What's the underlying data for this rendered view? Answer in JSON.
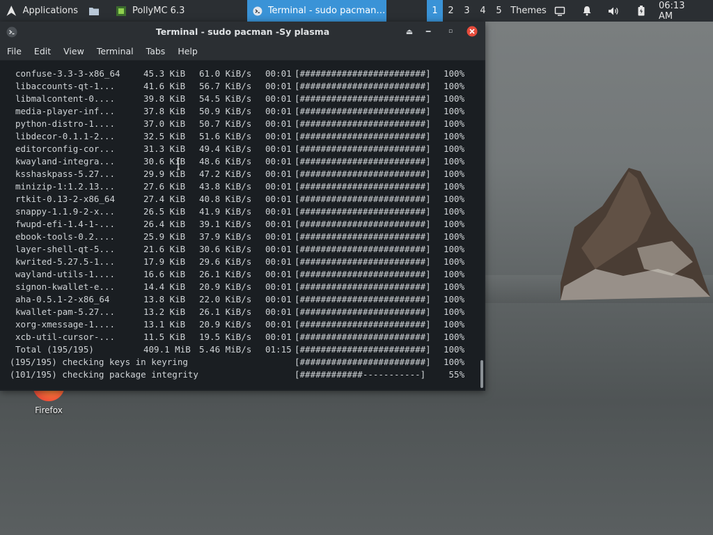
{
  "panel": {
    "applications_label": "Applications",
    "tasks": [
      {
        "label": "PollyMC 6.3"
      },
      {
        "label": "Terminal - sudo pacman -Sy ..."
      }
    ],
    "workspaces": [
      "1",
      "2",
      "3",
      "4",
      "5"
    ],
    "active_workspace": "1",
    "themes_label": "Themes",
    "clock": "06:13 AM"
  },
  "window": {
    "title": "Terminal - sudo pacman -Sy plasma",
    "menu": [
      "File",
      "Edit",
      "View",
      "Terminal",
      "Tabs",
      "Help"
    ]
  },
  "terminal": {
    "downloads": [
      {
        "name": "confuse-3.3-3-x86_64",
        "size": "45.3 KiB",
        "speed": "61.0 KiB/s",
        "time": "00:01",
        "bar": "[########################]",
        "pct": "100%"
      },
      {
        "name": "libaccounts-qt-1...",
        "size": "41.6 KiB",
        "speed": "56.7 KiB/s",
        "time": "00:01",
        "bar": "[########################]",
        "pct": "100%"
      },
      {
        "name": "libmalcontent-0....",
        "size": "39.8 KiB",
        "speed": "54.5 KiB/s",
        "time": "00:01",
        "bar": "[########################]",
        "pct": "100%"
      },
      {
        "name": "media-player-inf...",
        "size": "37.8 KiB",
        "speed": "50.9 KiB/s",
        "time": "00:01",
        "bar": "[########################]",
        "pct": "100%"
      },
      {
        "name": "python-distro-1....",
        "size": "37.0 KiB",
        "speed": "50.7 KiB/s",
        "time": "00:01",
        "bar": "[########################]",
        "pct": "100%"
      },
      {
        "name": "libdecor-0.1.1-2...",
        "size": "32.5 KiB",
        "speed": "51.6 KiB/s",
        "time": "00:01",
        "bar": "[########################]",
        "pct": "100%"
      },
      {
        "name": "editorconfig-cor...",
        "size": "31.3 KiB",
        "speed": "49.4 KiB/s",
        "time": "00:01",
        "bar": "[########################]",
        "pct": "100%"
      },
      {
        "name": "kwayland-integra...",
        "size": "30.6 KiB",
        "speed": "48.6 KiB/s",
        "time": "00:01",
        "bar": "[########################]",
        "pct": "100%"
      },
      {
        "name": "ksshaskpass-5.27...",
        "size": "29.9 KiB",
        "speed": "47.2 KiB/s",
        "time": "00:01",
        "bar": "[########################]",
        "pct": "100%"
      },
      {
        "name": "minizip-1:1.2.13...",
        "size": "27.6 KiB",
        "speed": "43.8 KiB/s",
        "time": "00:01",
        "bar": "[########################]",
        "pct": "100%"
      },
      {
        "name": "rtkit-0.13-2-x86_64",
        "size": "27.4 KiB",
        "speed": "40.8 KiB/s",
        "time": "00:01",
        "bar": "[########################]",
        "pct": "100%"
      },
      {
        "name": "snappy-1.1.9-2-x...",
        "size": "26.5 KiB",
        "speed": "41.9 KiB/s",
        "time": "00:01",
        "bar": "[########################]",
        "pct": "100%"
      },
      {
        "name": "fwupd-efi-1.4-1-...",
        "size": "26.4 KiB",
        "speed": "39.1 KiB/s",
        "time": "00:01",
        "bar": "[########################]",
        "pct": "100%"
      },
      {
        "name": "ebook-tools-0.2....",
        "size": "25.9 KiB",
        "speed": "37.9 KiB/s",
        "time": "00:01",
        "bar": "[########################]",
        "pct": "100%"
      },
      {
        "name": "layer-shell-qt-5...",
        "size": "21.6 KiB",
        "speed": "30.6 KiB/s",
        "time": "00:01",
        "bar": "[########################]",
        "pct": "100%"
      },
      {
        "name": "kwrited-5.27.5-1...",
        "size": "17.9 KiB",
        "speed": "29.6 KiB/s",
        "time": "00:01",
        "bar": "[########################]",
        "pct": "100%"
      },
      {
        "name": "wayland-utils-1....",
        "size": "16.6 KiB",
        "speed": "26.1 KiB/s",
        "time": "00:01",
        "bar": "[########################]",
        "pct": "100%"
      },
      {
        "name": "signon-kwallet-e...",
        "size": "14.4 KiB",
        "speed": "20.9 KiB/s",
        "time": "00:01",
        "bar": "[########################]",
        "pct": "100%"
      },
      {
        "name": "aha-0.5.1-2-x86_64",
        "size": "13.8 KiB",
        "speed": "22.0 KiB/s",
        "time": "00:01",
        "bar": "[########################]",
        "pct": "100%"
      },
      {
        "name": "kwallet-pam-5.27...",
        "size": "13.2 KiB",
        "speed": "26.1 KiB/s",
        "time": "00:01",
        "bar": "[########################]",
        "pct": "100%"
      },
      {
        "name": "xorg-xmessage-1....",
        "size": "13.1 KiB",
        "speed": "20.9 KiB/s",
        "time": "00:01",
        "bar": "[########################]",
        "pct": "100%"
      },
      {
        "name": "xcb-util-cursor-...",
        "size": "11.5 KiB",
        "speed": "19.5 KiB/s",
        "time": "00:01",
        "bar": "[########################]",
        "pct": "100%"
      },
      {
        "name": "Total (195/195)",
        "size": "409.1 MiB",
        "speed": "5.46 MiB/s",
        "time": "01:15",
        "bar": "[########################]",
        "pct": "100%"
      }
    ],
    "status": [
      {
        "text": "(195/195) checking keys in keyring",
        "bar": "[########################]",
        "pct": "100%"
      },
      {
        "text": "(101/195) checking package integrity",
        "bar": "[############-----------]",
        "pct": " 55%"
      }
    ]
  },
  "desktop": {
    "icons": [
      {
        "label": "Firefox",
        "icon": "firefox-icon"
      }
    ]
  }
}
